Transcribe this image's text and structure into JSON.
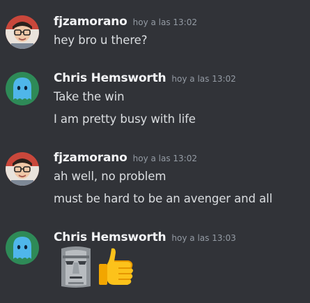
{
  "messages": [
    {
      "username": "fjzamorano",
      "timestamp": "hoy a las 13:02",
      "lines": [
        "hey bro u there?"
      ]
    },
    {
      "username": "Chris Hemsworth",
      "timestamp": "hoy a las 13:02",
      "lines": [
        "Take the win",
        "I am pretty busy with life"
      ]
    },
    {
      "username": "fjzamorano",
      "timestamp": "hoy a las 13:02",
      "lines": [
        "ah well, no problem",
        "must be hard to be an avenger and all"
      ]
    },
    {
      "username": "Chris Hemsworth",
      "timestamp": "hoy a las 13:03",
      "emojis": [
        "moai-emoji",
        "thumbs-up-emoji"
      ]
    }
  ],
  "colors": {
    "background": "#313338",
    "username": "#f2f3f5",
    "text": "#dbdee1",
    "timestamp": "#949ba4"
  }
}
